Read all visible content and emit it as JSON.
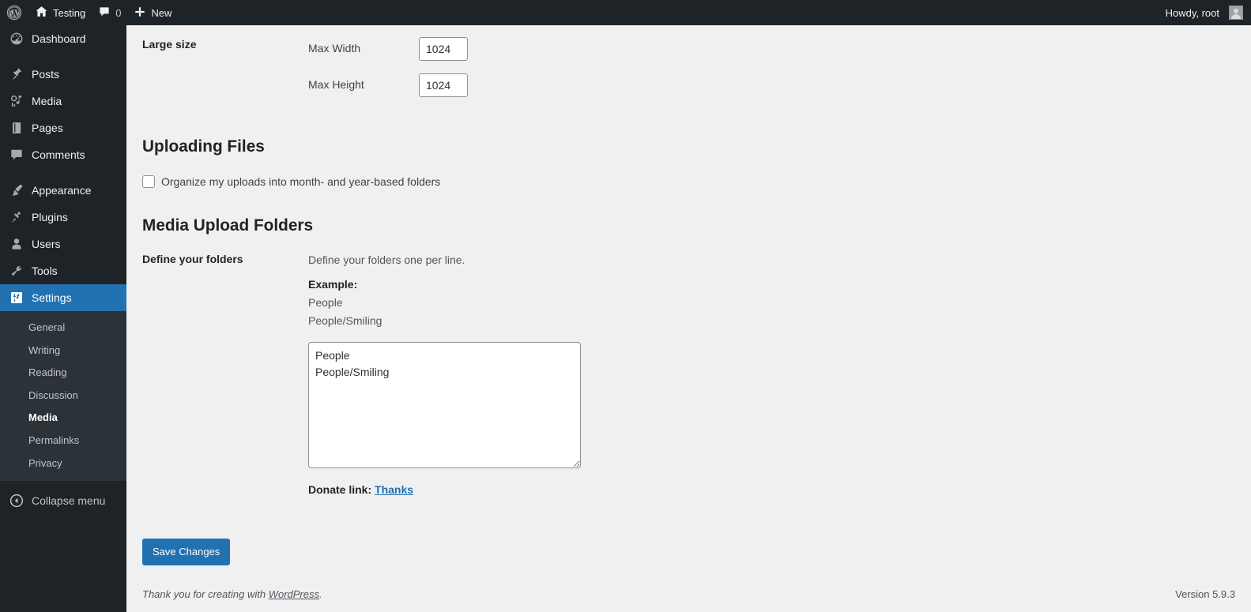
{
  "adminbar": {
    "logo_icon": "wordpress-logo-icon",
    "site_icon": "home-icon",
    "site_name": "Testing",
    "comments_icon": "comment-bubble-icon",
    "comments_count": "0",
    "new_icon": "plus-icon",
    "new_label": "New",
    "howdy": "Howdy, root",
    "avatar": "avatar"
  },
  "sidebar": {
    "items": [
      {
        "label": "Dashboard",
        "icon": "dashboard-icon",
        "gap_before": false
      },
      {
        "label": "Posts",
        "icon": "pin-icon",
        "gap_before": true
      },
      {
        "label": "Media",
        "icon": "media-icon",
        "gap_before": false
      },
      {
        "label": "Pages",
        "icon": "pages-icon",
        "gap_before": false
      },
      {
        "label": "Comments",
        "icon": "comments-icon",
        "gap_before": false
      },
      {
        "label": "Appearance",
        "icon": "appearance-brush-icon",
        "gap_before": true
      },
      {
        "label": "Plugins",
        "icon": "plugins-plug-icon",
        "gap_before": false
      },
      {
        "label": "Users",
        "icon": "users-icon",
        "gap_before": false
      },
      {
        "label": "Tools",
        "icon": "tools-wrench-icon",
        "gap_before": false
      },
      {
        "label": "Settings",
        "icon": "settings-sliders-icon",
        "gap_before": false,
        "current": true
      }
    ],
    "submenu": [
      {
        "label": "General"
      },
      {
        "label": "Writing"
      },
      {
        "label": "Reading"
      },
      {
        "label": "Discussion"
      },
      {
        "label": "Media",
        "current": true
      },
      {
        "label": "Permalinks"
      },
      {
        "label": "Privacy"
      }
    ],
    "collapse": {
      "label": "Collapse menu",
      "icon": "collapse-arrow-left-icon"
    }
  },
  "main": {
    "image_sizes": {
      "large_label": "Large size",
      "max_width_label": "Max Width",
      "max_width_value": "1024",
      "max_height_label": "Max Height",
      "max_height_value": "1024"
    },
    "uploading_files": {
      "heading": "Uploading Files",
      "organize_label": "Organize my uploads into month- and year-based folders",
      "organize_checked": false
    },
    "media_upload_folders": {
      "heading": "Media Upload Folders",
      "field_label": "Define your folders",
      "description": "Define your folders one per line.",
      "example_label": "Example:",
      "example_lines": [
        "People",
        "People/Smiling"
      ],
      "textarea_value": "People\nPeople/Smiling",
      "donate_label": "Donate link:",
      "donate_link_text": "Thanks"
    },
    "save_button": "Save Changes"
  },
  "footer": {
    "thanks_prefix": "Thank you for creating with ",
    "thanks_link": "WordPress",
    "thanks_suffix": ".",
    "version": "Version 5.9.3"
  },
  "colors": {
    "admin_bar_bg": "#1d2327",
    "sidebar_bg": "#1d2327",
    "submenu_bg": "#2c3338",
    "accent_blue": "#2271b1",
    "content_bg": "#f0f0f1"
  }
}
